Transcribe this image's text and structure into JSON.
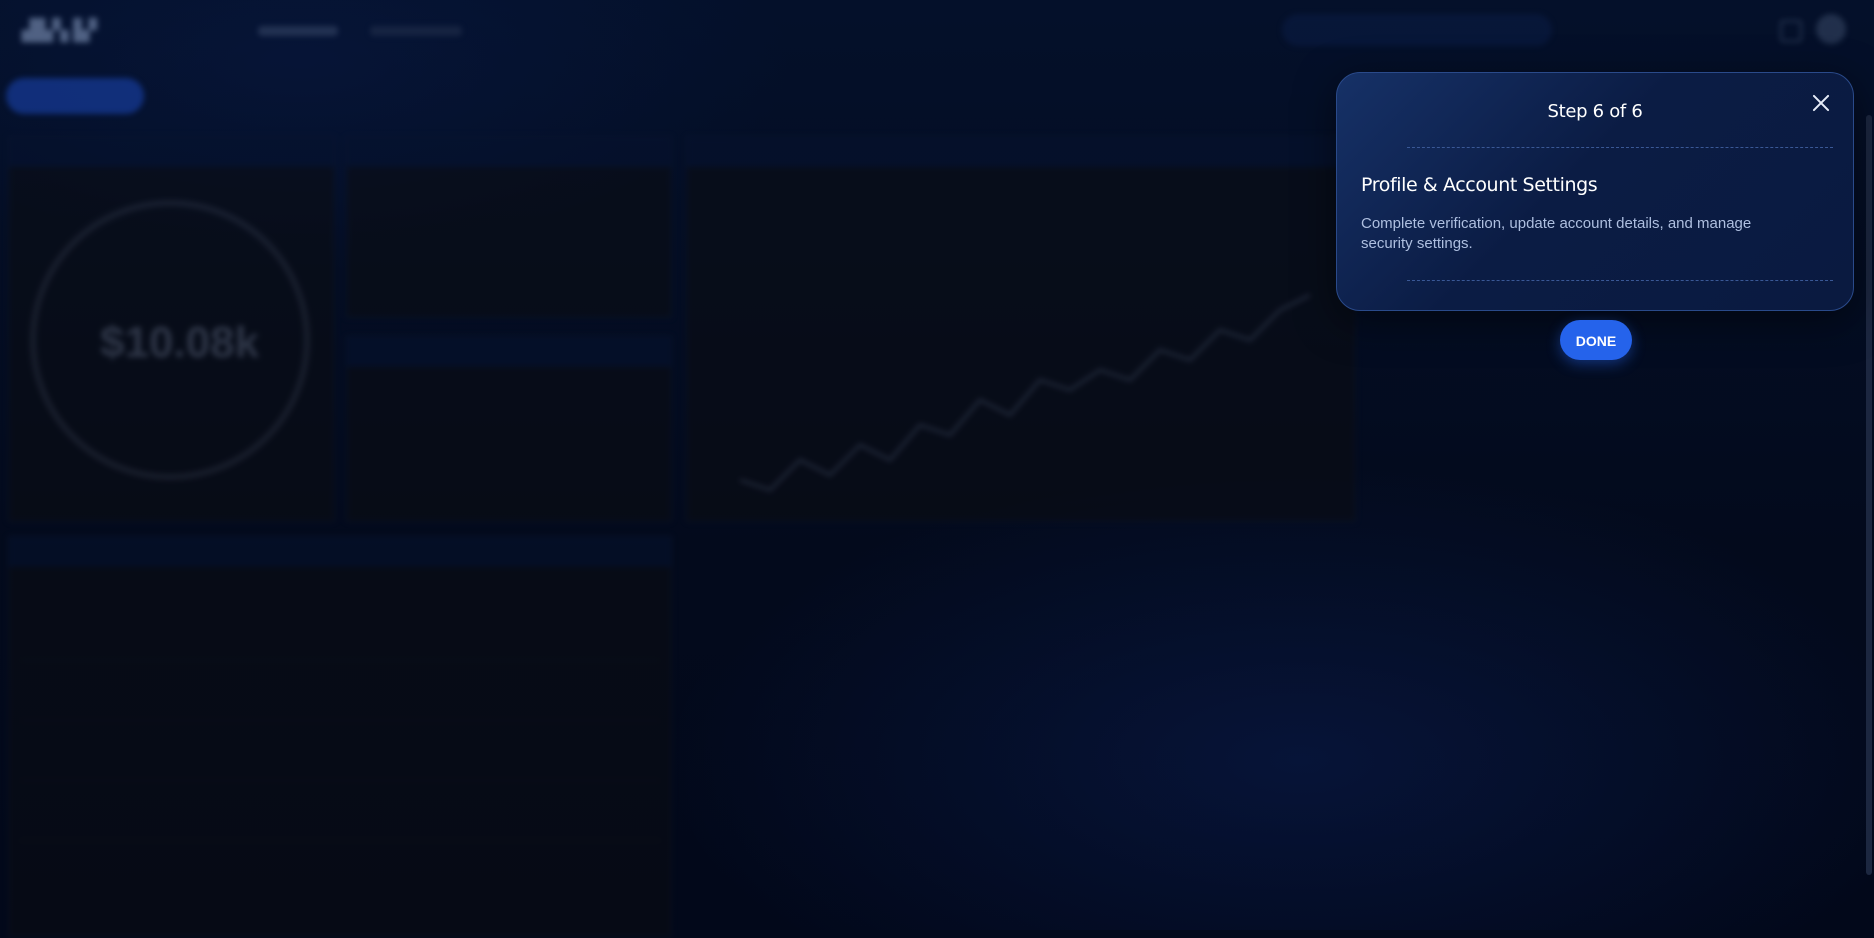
{
  "tour": {
    "step_label": "Step 6 of 6",
    "heading": "Profile & Account Settings",
    "body": "Complete verification, update account details, and manage security settings.",
    "done_label": "DONE"
  },
  "colors": {
    "accent": "#2563eb",
    "popover_bg": "#0b1c44",
    "page_bg": "#030a1c"
  },
  "background": {
    "balance_value": "$10.08k"
  }
}
